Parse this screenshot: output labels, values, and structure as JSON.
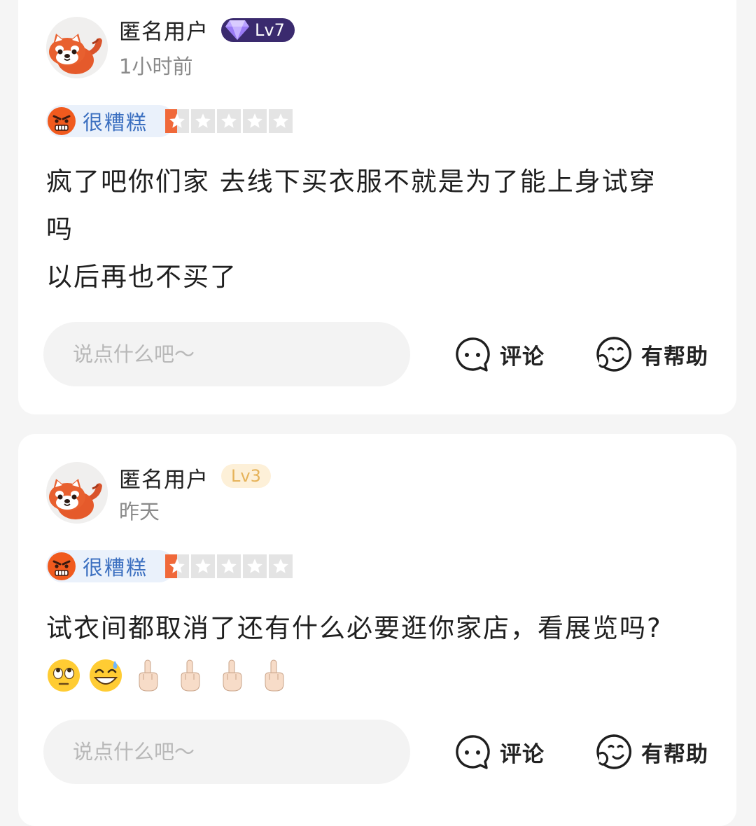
{
  "reviews": [
    {
      "username": "匿名用户",
      "level": "Lv7",
      "time": "1小时前",
      "rating_label": "很糟糕",
      "rating": 0.5,
      "text": "疯了吧你们家 去线下买衣服不就是为了能上身试穿\n吗\n以后再也不买了",
      "reply_placeholder": "说点什么吧～",
      "comment_label": "评论",
      "helpful_label": "有帮助"
    },
    {
      "username": "匿名用户",
      "level": "Lv3",
      "time": "昨天",
      "rating_label": "很糟糕",
      "rating": 0.5,
      "text": "试衣间都取消了还有什么必要逛你家店，看展览吗?",
      "emojis": [
        "face-with-rolling-eyes",
        "grinning-face-with-sweat",
        "middle-finger",
        "middle-finger",
        "middle-finger",
        "middle-finger"
      ],
      "reply_placeholder": "说点什么吧～",
      "comment_label": "评论",
      "helpful_label": "有帮助"
    }
  ],
  "colors": {
    "lv7_badge": "#3a2a6e",
    "lv3_badge": "#fdf0d8",
    "rating_pill": "#eaf1fb",
    "rating_text": "#3b6fc0",
    "star_active": "#f0693a",
    "star_inactive": "#e4e4e4"
  }
}
